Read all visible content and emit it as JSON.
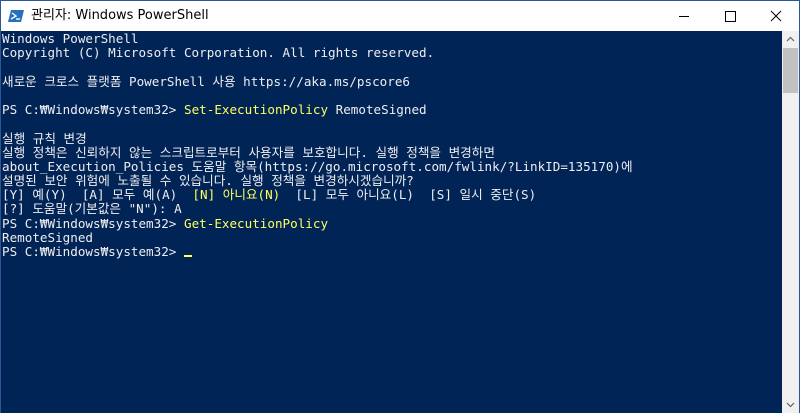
{
  "window": {
    "title": "관리자: Windows PowerShell",
    "icon": "powershell-icon",
    "controls": {
      "minimize": "minimize-icon",
      "maximize": "maximize-icon",
      "close": "close-icon"
    }
  },
  "colors": {
    "console_bg": "#012456",
    "text": "#eeedf0",
    "command": "#ffff60",
    "title_border": "#2b5797"
  },
  "console": {
    "banner1": "Windows PowerShell",
    "banner2": "Copyright (C) Microsoft Corporation. All rights reserved.",
    "banner3": "새로운 크로스 플랫폼 PowerShell 사용 https://aka.ms/pscore6",
    "prompt": "PS C:₩Windows₩system32> ",
    "cmd1": "Set-ExecutionPolicy",
    "cmd1_arg": " RemoteSigned",
    "policy_title": "실행 규칙 변경",
    "policy_msg1": "실행 정책은 신뢰하지 않는 스크립트로부터 사용자를 보호합니다. 실행 정책을 변경하면",
    "policy_msg2": "about_Execution_Policies 도움말 항목(https://go.microsoft.com/fwlink/?LinkID=135170)에",
    "policy_msg3": "설명된 보안 위험에 노출될 수 있습니다. 실행 정책을 변경하시겠습니까?",
    "choice_y": "[Y] 예(Y)  ",
    "choice_a": "[A] 모두 예(A)  ",
    "choice_n": "[N] 아니요(N)",
    "choice_l": "  [L] 모두 아니요(L)  ",
    "choice_s": "[S] 일시 중단(S)",
    "help_line": "[?] 도움말(기본값은 \"N\"): A",
    "cmd2": "Get-ExecutionPolicy",
    "output": "RemoteSigned"
  }
}
